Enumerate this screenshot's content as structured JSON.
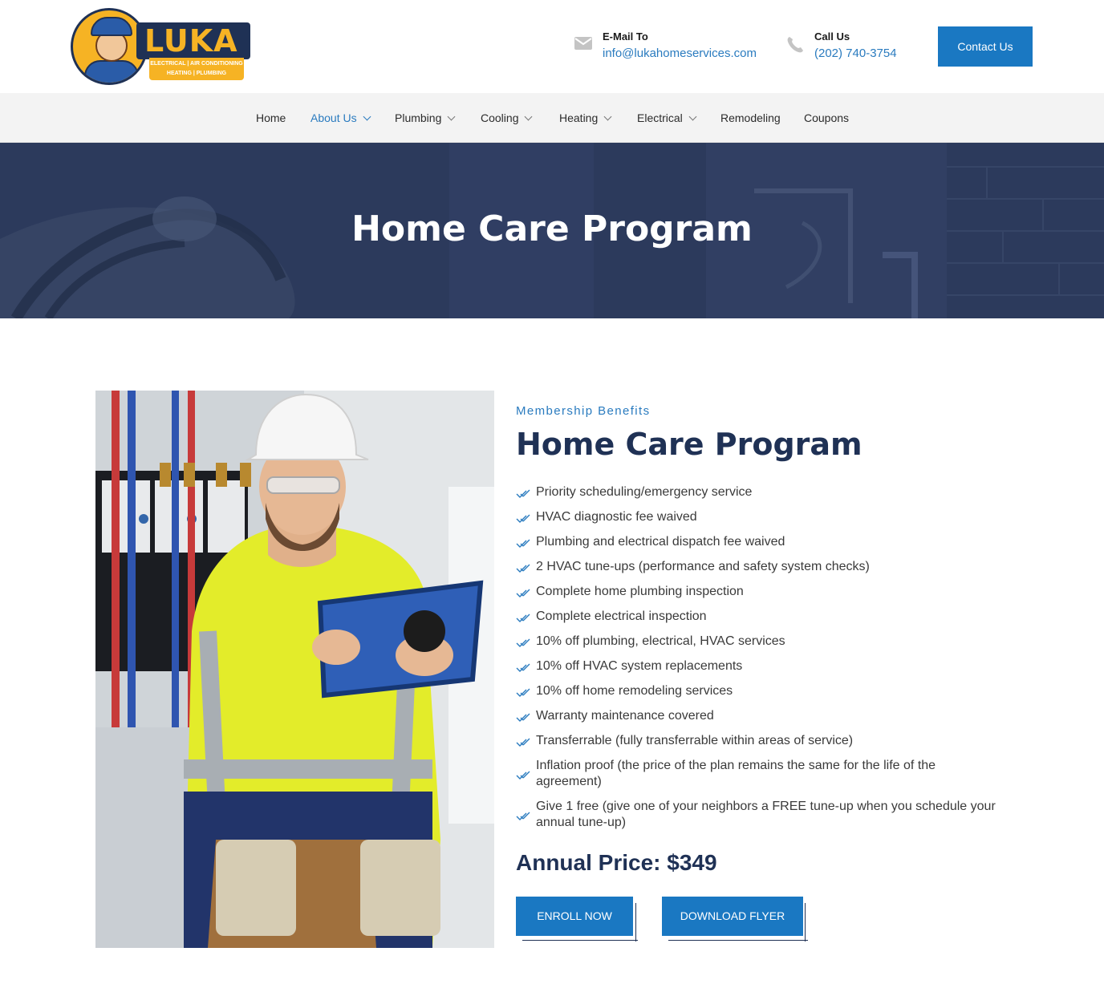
{
  "brand": {
    "name": "LUKA",
    "tagline_line1": "ELECTRICAL | AIR CONDITIONING",
    "tagline_line2": "HEATING | PLUMBING",
    "cap_text": "LUKA"
  },
  "header": {
    "email": {
      "label": "E-Mail To",
      "value": "info@lukahomeservices.com",
      "icon": "envelope-icon"
    },
    "phone": {
      "label": "Call Us",
      "value": "(202) 740-3754",
      "icon": "phone-icon"
    },
    "contact_button": "Contact Us"
  },
  "nav": {
    "items": [
      {
        "label": "Home",
        "dropdown": false
      },
      {
        "label": "About Us",
        "dropdown": true,
        "active": true
      },
      {
        "label": "Plumbing",
        "dropdown": true
      },
      {
        "label": "Cooling",
        "dropdown": true
      },
      {
        "label": "Heating",
        "dropdown": true
      },
      {
        "label": "Electrical",
        "dropdown": true
      },
      {
        "label": "Remodeling",
        "dropdown": false
      },
      {
        "label": "Coupons",
        "dropdown": false
      }
    ]
  },
  "hero": {
    "title": "Home Care Program"
  },
  "content": {
    "eyebrow": "Membership Benefits",
    "title": "Home Care Program",
    "benefits": [
      "Priority scheduling/emergency service",
      "HVAC diagnostic fee waived",
      "Plumbing and electrical dispatch fee waived",
      "2 HVAC tune-ups (performance and safety system checks)",
      "Complete home plumbing inspection",
      "Complete electrical inspection",
      "10% off plumbing, electrical, HVAC services",
      "10% off HVAC system replacements",
      "10% off home remodeling services",
      "Warranty maintenance covered",
      "Transferrable (fully transferrable within areas of service)",
      "Inflation proof (the price of the plan remains the same for the life of the agreement)",
      "Give 1 free (give one of your neighbors a FREE tune-up when you schedule your annual tune-up)"
    ],
    "price": "Annual Price: $349",
    "buttons": {
      "enroll": "ENROLL NOW",
      "download": "DOWNLOAD FLYER"
    }
  },
  "colors": {
    "accent": "#1a78c2",
    "navy": "#1f3155",
    "hero_overlay": "#2c3a5c",
    "logo_yellow": "#f6b324"
  }
}
